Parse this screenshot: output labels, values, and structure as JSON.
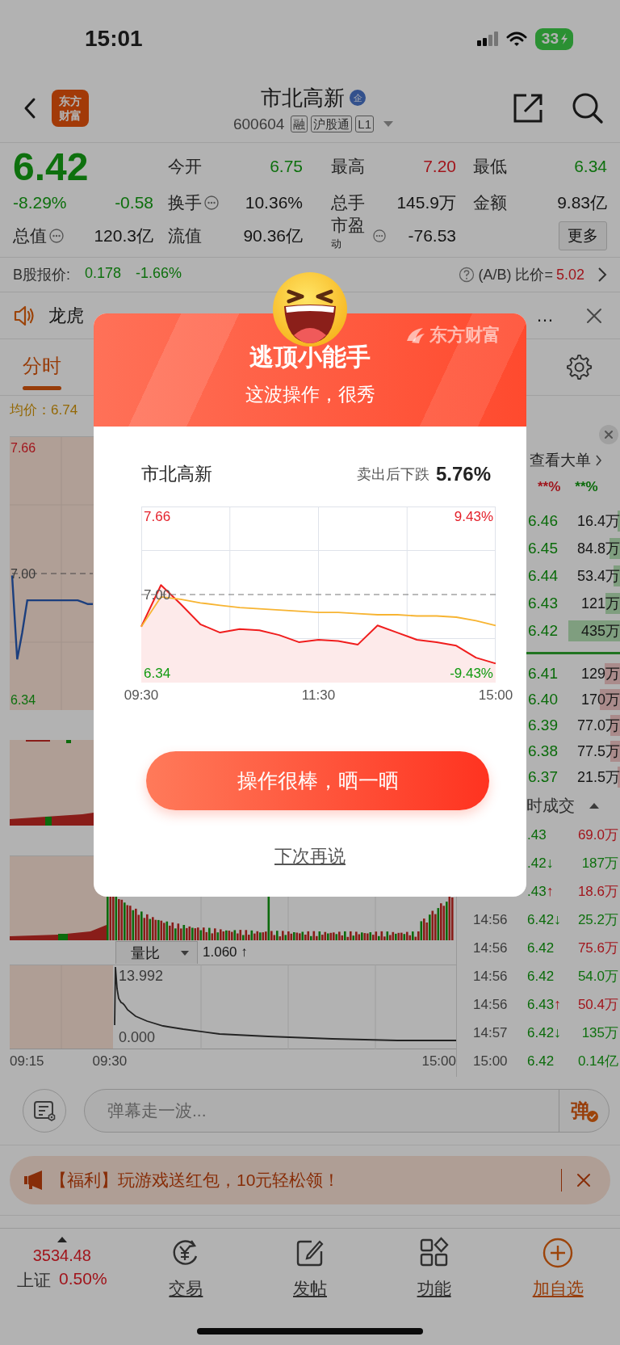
{
  "status_bar": {
    "time": "15:01",
    "battery": "33"
  },
  "nav": {
    "logo_text": [
      "东方",
      "财富"
    ],
    "title": "市北高新",
    "title_badge": "企",
    "code": "600604",
    "tags": [
      "融",
      "沪股通",
      "L1"
    ]
  },
  "quote": {
    "price": "6.42",
    "change_pct": "-8.29%",
    "change": "-0.58",
    "color": "#0e700e",
    "total_value": {
      "label": "总值",
      "value": "120.3亿",
      "info": true
    },
    "stats": [
      {
        "label": "今开",
        "value": "6.75",
        "color": "#0e700e",
        "info": false
      },
      {
        "label": "最高",
        "value": "7.20",
        "color": "#a1151c",
        "info": false
      },
      {
        "label": "最低",
        "value": "6.34",
        "color": "#0e700e",
        "info": false
      },
      {
        "label": "换手",
        "value": "10.36%",
        "color": "#151515",
        "info": true
      },
      {
        "label": "总手",
        "value": "145.9万",
        "color": "#151515",
        "info": false
      },
      {
        "label": "金额",
        "value": "9.83亿",
        "color": "#151515",
        "info": false
      },
      {
        "label": "流值",
        "value": "90.36亿",
        "color": "#151515",
        "info": false
      },
      {
        "label": "市盈$^{动}$",
        "value": "-76.53",
        "color": "#151515",
        "info": true
      }
    ],
    "more_button": "更多"
  },
  "b_share": {
    "label": "B股报价:",
    "price": "0.178",
    "change": "-1.66%",
    "color": "#0e700e",
    "ratio_label": "(A/B) 比价=",
    "ratio": "5.02"
  },
  "ticker": {
    "text": "龙虎",
    "tail": "…"
  },
  "tabs": [
    {
      "label": "分时",
      "selected": true
    }
  ],
  "chart_panel": {
    "avg_price": "均价：6.74",
    "price_chart": {
      "chart_data": {
        "type": "line",
        "categories": [
          null,
          null,
          null,
          null,
          null,
          null,
          null,
          null,
          null,
          null,
          null,
          null,
          null,
          null,
          null,
          null,
          null
        ],
        "ylim": [
          6.28,
          7.72
        ],
        "yticks": [
          {
            "value": 7.66,
            "label": "7.66"
          },
          {
            "value": 7.0,
            "label": "7.00"
          },
          {
            "value": 6.34,
            "label": "6.34"
          }
        ],
        "series": [
          {
            "color": "#1c3f7e",
            "values": [
              6.99,
              6.55,
              6.69,
              6.86,
              6.86,
              6.86,
              6.86,
              6.86,
              6.86,
              6.86,
              6.86,
              6.86,
              6.86,
              6.86,
              6.85,
              6.84,
              6.84
            ]
          },
          {
            "color": "#474747",
            "line_style": "dashed",
            "values": [
              7.0,
              7.0,
              7.0,
              7.0,
              7.0,
              7.0,
              7.0,
              7.0,
              7.0,
              7.0,
              7.0,
              7.0,
              7.0,
              7.0,
              7.0,
              7.0,
              7.0
            ]
          }
        ]
      }
    },
    "indicator": "量比",
    "indicator_value": "1.060 ↑",
    "ratio_high": "13.992",
    "ratio_low": "0.000",
    "times": [
      "09:15",
      "09:30",
      "15:00"
    ]
  },
  "order_book": {
    "link": "查看大单",
    "ratio_up": "**%",
    "ratio_down": "**%",
    "asks": [
      {
        "price": "6.46",
        "volume": "16.4万"
      },
      {
        "price": "6.45",
        "volume": "84.8万"
      },
      {
        "price": "6.44",
        "volume": "53.4万"
      },
      {
        "price": "6.43",
        "volume": "121万"
      },
      {
        "price": "6.42",
        "volume": "435万"
      }
    ],
    "bids": [
      {
        "price": "6.41",
        "volume": "129万"
      },
      {
        "price": "6.40",
        "volume": "170万"
      },
      {
        "price": "6.39",
        "volume": "77.0万"
      },
      {
        "price": "6.38",
        "volume": "77.5万"
      },
      {
        "price": "6.37",
        "volume": "21.5万"
      }
    ]
  },
  "trades_header": "时成交",
  "trades": [
    {
      "price": ".43",
      "volume": "69.0万",
      "color": "#a1151c"
    },
    {
      "price": ".42",
      "arrow": "↓",
      "volume": "187万",
      "color": "#0e700e"
    },
    {
      "price": ".43",
      "arrow": "↑",
      "volume": "18.6万",
      "color": "#a1151c"
    },
    {
      "time": "14:56",
      "price": "6.42",
      "arrow": "↓",
      "volume": "25.2万",
      "color": "#0e700e"
    },
    {
      "time": "14:56",
      "price": "6.42",
      "volume": "75.6万",
      "color": "#a1151c"
    },
    {
      "time": "14:56",
      "price": "6.42",
      "volume": "54.0万",
      "color": "#0e700e"
    },
    {
      "time": "14:56",
      "price": "6.43",
      "arrow": "↑",
      "volume": "50.4万",
      "color": "#a1151c"
    },
    {
      "time": "14:57",
      "price": "6.42",
      "arrow": "↓",
      "volume": "135万",
      "color": "#0e700e"
    },
    {
      "time": "15:00",
      "price": "6.42",
      "volume": "0.14亿",
      "color": "#0e700e"
    }
  ],
  "comment_bar": {
    "placeholder": "弹幕走一波...",
    "send_label": "弹"
  },
  "banner": {
    "text": "【福利】玩游戏送红包，10元轻松领！"
  },
  "bottom_nav": {
    "index": {
      "value": "3534.48",
      "name": "上证",
      "change": "0.50%",
      "color": "#a1151c"
    },
    "items": [
      {
        "label": "交易",
        "kind": "trade"
      },
      {
        "label": "发帖",
        "kind": "post"
      },
      {
        "label": "功能",
        "kind": "features"
      },
      {
        "label": "加自选",
        "kind": "add"
      }
    ]
  },
  "modal": {
    "header_logo": "东方财富",
    "title": "逃顶小能手",
    "subtitle": "这波操作，很秀",
    "stock": "市北高新",
    "drop_label": "卖出后下跌",
    "drop_value": "5.76%",
    "pct_high": "9.43%",
    "pct_low": "-9.43%",
    "chart_data": {
      "type": "line",
      "grid": true,
      "categories": [
        "09:30",
        null,
        null,
        null,
        null,
        null,
        null,
        null,
        null,
        "11:30",
        null,
        null,
        null,
        null,
        null,
        null,
        null,
        null,
        "15:00"
      ],
      "ylim": [
        6.26,
        7.74
      ],
      "yticks": [
        {
          "value": 7.66,
          "label": "7.66"
        },
        {
          "value": 7.0,
          "label": "7.00"
        },
        {
          "value": 6.34,
          "label": "6.34"
        }
      ],
      "series": [
        {
          "color": "#f01d1d",
          "values": [
            6.73,
            7.08,
            6.92,
            6.75,
            6.68,
            6.71,
            6.7,
            6.66,
            6.6,
            6.62,
            6.61,
            6.58,
            6.74,
            6.68,
            6.62,
            6.6,
            6.57,
            6.47,
            6.42
          ]
        },
        {
          "color": "#f7b432",
          "values": [
            6.73,
            6.98,
            6.96,
            6.93,
            6.91,
            6.89,
            6.88,
            6.87,
            6.86,
            6.85,
            6.85,
            6.84,
            6.83,
            6.83,
            6.82,
            6.82,
            6.81,
            6.78,
            6.74
          ]
        },
        {
          "color": "#777777",
          "line_style": "dashed",
          "values": [
            7.0,
            7.0,
            7.0,
            7.0,
            7.0,
            7.0,
            7.0,
            7.0,
            7.0,
            7.0,
            7.0,
            7.0,
            7.0,
            7.0,
            7.0,
            7.0,
            7.0,
            7.0,
            7.0
          ]
        }
      ]
    },
    "share_button": "操作很棒，晒一晒",
    "dismiss_link": "下次再说"
  }
}
